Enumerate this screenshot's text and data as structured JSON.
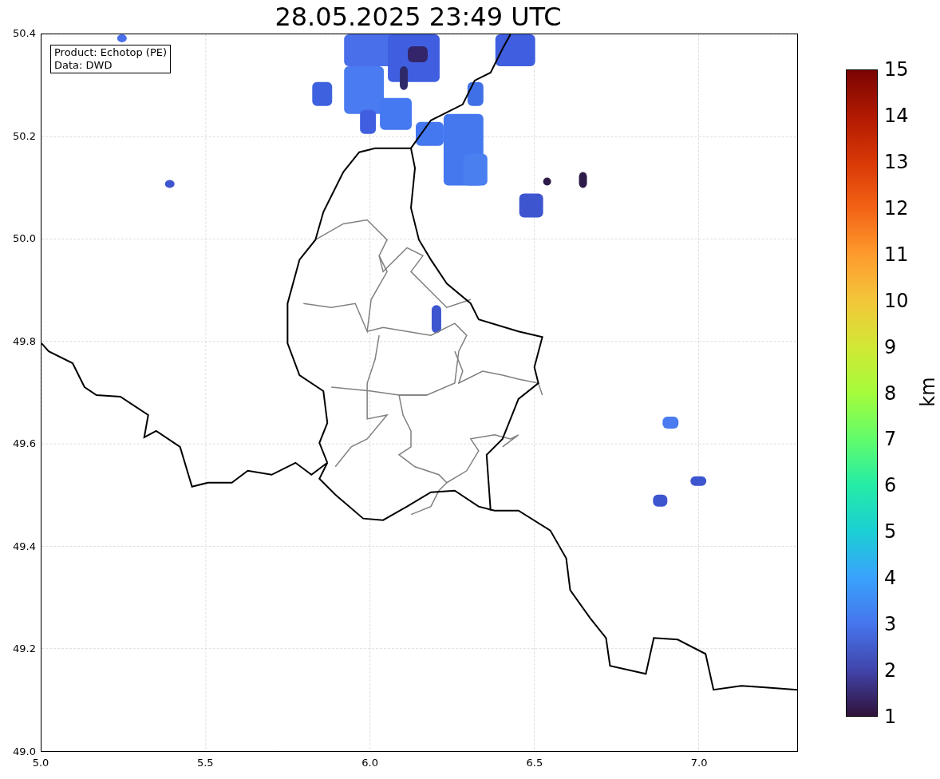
{
  "title": "28.05.2025 23:49 UTC",
  "info_box": [
    "Product: Echotop (PE)",
    "Data: DWD"
  ],
  "x_axis": {
    "ticks": [
      "5.0",
      "5.5",
      "6.0",
      "6.5",
      "7.0"
    ]
  },
  "y_axis": {
    "ticks": [
      "50.4",
      "50.2",
      "50.0",
      "49.8",
      "49.6",
      "49.4",
      "49.2",
      "49.0"
    ]
  },
  "colorbar": {
    "label": "km",
    "ticks": [
      "15",
      "14",
      "13",
      "12",
      "11",
      "10",
      "9",
      "8",
      "7",
      "6",
      "5",
      "4",
      "3",
      "2",
      "1"
    ]
  }
}
